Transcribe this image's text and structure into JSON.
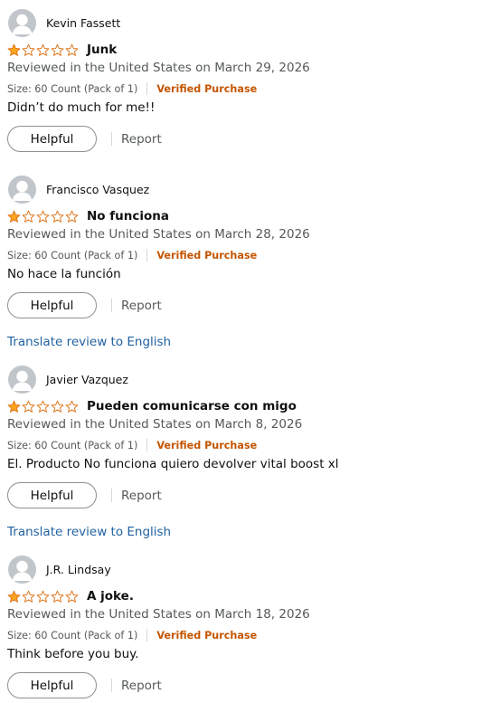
{
  "colors": {
    "star_filled": "#ffa41c",
    "star_outline": "#de7921",
    "verified": "#c45500",
    "link": "#2162a1",
    "meta_text": "#565959",
    "avatar_bg": "#c1c6cb"
  },
  "icons": {
    "avatar": "default-user-avatar-icon",
    "star_filled": "star-filled-icon",
    "star_empty": "star-empty-icon"
  },
  "reviews": [
    {
      "reviewer": "Kevin Fassett",
      "rating": 1,
      "rating_max": 5,
      "title": "Junk",
      "date_line": "Reviewed in the United States on March 29, 2026",
      "format": "Size: 60 Count (Pack of 1)",
      "verified": "Verified Purchase",
      "body": "Didn’t do much for me!!",
      "helpful_label": "Helpful",
      "report_label": "Report",
      "translate_label": ""
    },
    {
      "reviewer": "Francisco Vasquez",
      "rating": 1,
      "rating_max": 5,
      "title": "No funciona",
      "date_line": "Reviewed in the United States on March 28, 2026",
      "format": "Size: 60 Count (Pack of 1)",
      "verified": "Verified Purchase",
      "body": "No hace la función",
      "helpful_label": "Helpful",
      "report_label": "Report",
      "translate_label": "Translate review to English"
    },
    {
      "reviewer": "Javier Vazquez",
      "rating": 1,
      "rating_max": 5,
      "title": "Pueden comunicarse con migo",
      "date_line": "Reviewed in the United States on March 8, 2026",
      "format": "Size: 60 Count (Pack of 1)",
      "verified": "Verified Purchase",
      "body": "El. Producto No funciona quiero devolver vital boost xl",
      "helpful_label": "Helpful",
      "report_label": "Report",
      "translate_label": "Translate review to English"
    },
    {
      "reviewer": "J.R. Lindsay",
      "rating": 1,
      "rating_max": 5,
      "title": "A joke.",
      "date_line": "Reviewed in the United States on March 18, 2026",
      "format": "Size: 60 Count (Pack of 1)",
      "verified": "Verified Purchase",
      "body": "Think before you buy.",
      "helpful_label": "Helpful",
      "report_label": "Report",
      "translate_label": ""
    }
  ]
}
